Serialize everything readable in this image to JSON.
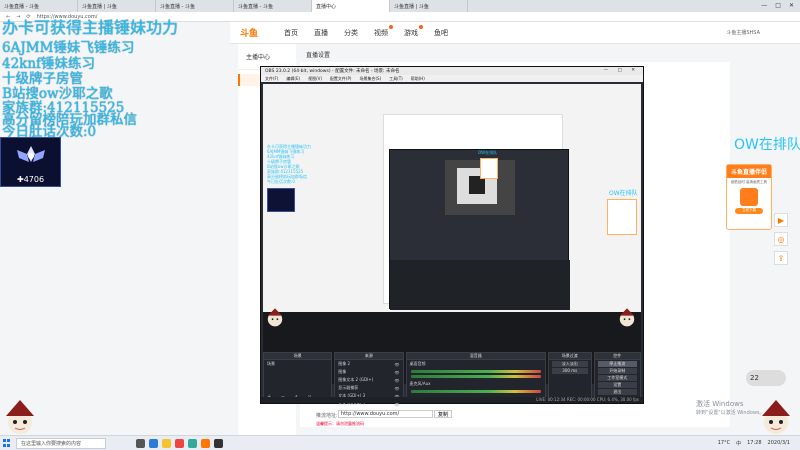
{
  "browser": {
    "tabs": [
      "斗鱼直播 - 斗鱼",
      "斗鱼直播 | 斗鱼",
      "斗鱼直播 - 斗鱼",
      "斗鱼直播 - 斗鱼",
      "直播中心",
      "斗鱼直播 | 斗鱼"
    ],
    "active_tab": 4,
    "window_controls": [
      "—",
      "□",
      "✕"
    ],
    "address": "https://www.douyu.com/"
  },
  "douyu": {
    "logo": "斗鱼",
    "nav": [
      "首页",
      "直播",
      "分类",
      "视频",
      "游戏",
      "鱼吧"
    ],
    "user": "斗鱼主播SHSA",
    "sidebar_title": "主播中心",
    "content_title": "直播设置",
    "push_label": "推流地址:",
    "push_value": "http://www.douyu.com/",
    "push_button": "复制",
    "push_tip": "温馨提示：请勿泄露推流码"
  },
  "obs": {
    "title": "OBS 23.0.2 (64-bit, windows) - 配置文件: 未命名 - 场景: 未命名",
    "menu": [
      "文件(F)",
      "编辑(E)",
      "视图(V)",
      "配置文件(P)",
      "场景集合(S)",
      "工具(T)",
      "帮助(H)"
    ],
    "docks": {
      "scenes_header": "场景",
      "scenes": [
        "场景"
      ],
      "sources_header": "来源",
      "sources": [
        "图像 2",
        "图像",
        "图像文本 2 (GDI+)",
        "显示器捕获",
        "文本 (GDI+) 3",
        "文本 (GDI+) 2"
      ],
      "mixer_header": "混音器",
      "mixer": [
        "桌面音频",
        "麦克风/Aux"
      ],
      "transitions_header": "场景过渡",
      "transition_value": "淡入淡出",
      "transition_duration": "300 ms",
      "controls_header": "控件",
      "controls": [
        "停止推流",
        "开始录制",
        "工作室模式",
        "设置",
        "退出"
      ]
    },
    "status": "LIVE: 00:12:34  REC: 00:00:00  CPU: 6.4%, 30.00 fps"
  },
  "overlay": {
    "title": "办卡可获得主播锤妹功力",
    "lines": [
      "6AJMM锤妹飞锤练习",
      "42knf锤妹练习",
      "十级牌子房管",
      "B站搜ow沙耶之歌",
      "家族群:412115525",
      "高分留榜陪玩加群私信",
      "今日肚话次数:0"
    ],
    "rank": "4706",
    "ow_right": "OW在排队",
    "promo_title": "斗鱼直播伴侣",
    "promo_sub": "超低延时 高清画质工具",
    "promo_button": "立即下载",
    "round_badge": "22",
    "win_activate_1": "激活 Windows",
    "win_activate_2": "转到\"设置\"以激活 Windows。"
  },
  "taskbar": {
    "search_placeholder": "在这里输入你要搜索的内容",
    "tray": [
      "17°C",
      "中",
      "17:28",
      "2020/3/1"
    ]
  },
  "colors": {
    "overlay_cyan": "#27c4f5",
    "douyu_orange": "#ff7700",
    "obs_bg": "#292c33"
  }
}
